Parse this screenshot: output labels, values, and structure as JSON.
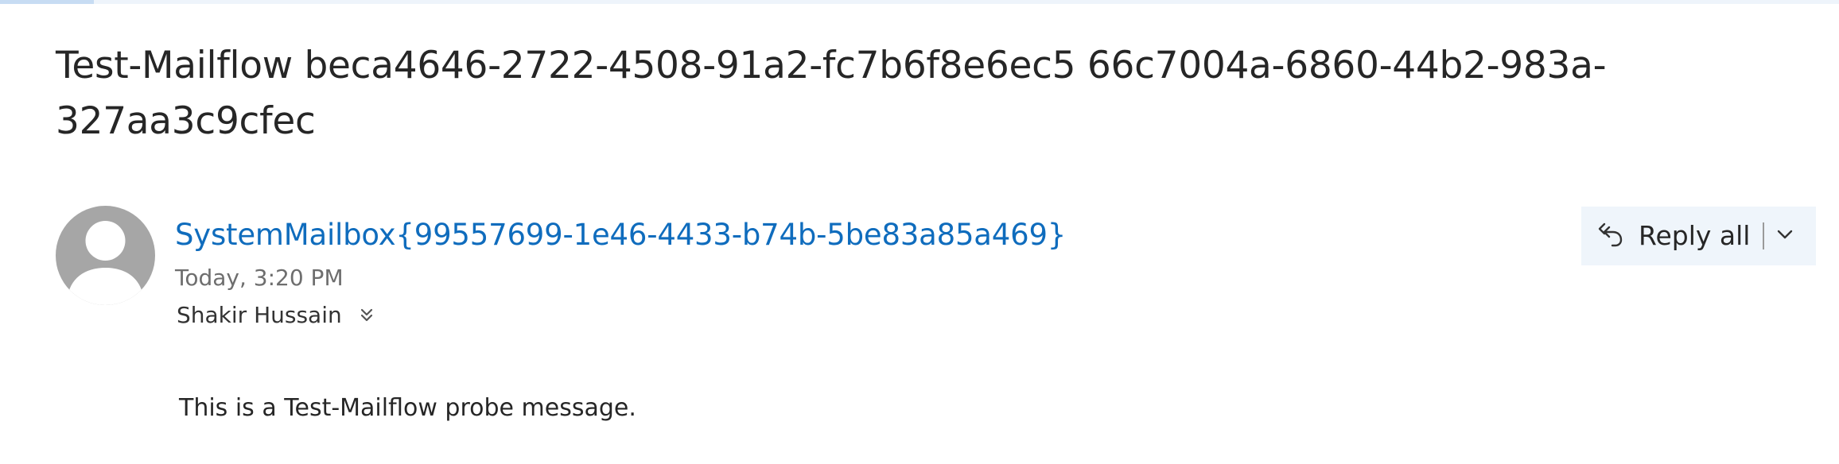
{
  "message": {
    "subject": "Test-Mailflow beca4646-2722-4508-91a2-fc7b6f8e6ec5 66c7004a-6860-44b2-983a-327aa3c9cfec",
    "sender": "SystemMailbox{99557699-1e46-4433-b74b-5be83a85a469}",
    "timestamp": "Today, 3:20 PM",
    "recipient": "Shakir Hussain",
    "body": "This is a Test-Mailflow probe message."
  },
  "actions": {
    "reply_all_label": "Reply all",
    "reply_all_icon": "reply-all-icon",
    "dropdown_icon": "chevron-down-icon",
    "expand_recipients_icon": "double-chevron-down-icon"
  },
  "colors": {
    "sender_link": "#0f6cbd",
    "avatar": "#a6a6a6",
    "reply_button_bg": "#eff5fb",
    "timestamp": "#6e6e6e"
  }
}
